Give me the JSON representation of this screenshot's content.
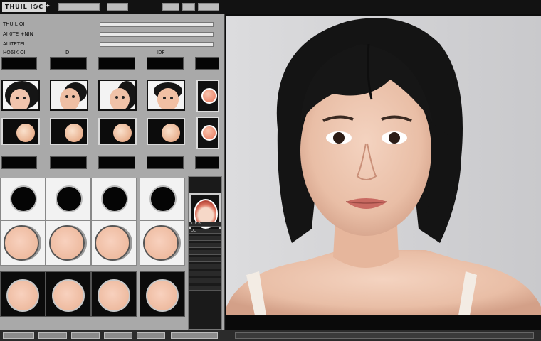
{
  "app": {
    "title": "THUIL IOC",
    "top_icons": [
      "gear-icon",
      "sparkle-icon"
    ]
  },
  "left_panel": {
    "lines": [
      {
        "text": "THUIL OI"
      },
      {
        "text": "AI 0TE +NIN"
      },
      {
        "text": "AI ITETEI"
      },
      {
        "text": "HO6IK OI"
      }
    ],
    "column_marks": [
      "D",
      "IDF"
    ],
    "side_labels": [
      "T. E B",
      "OC"
    ]
  },
  "colors": {
    "panel_bg": "#a9a9a9",
    "skin": "#eebba0",
    "photo_bg": "#d4d4d6",
    "hair": "#161616"
  }
}
